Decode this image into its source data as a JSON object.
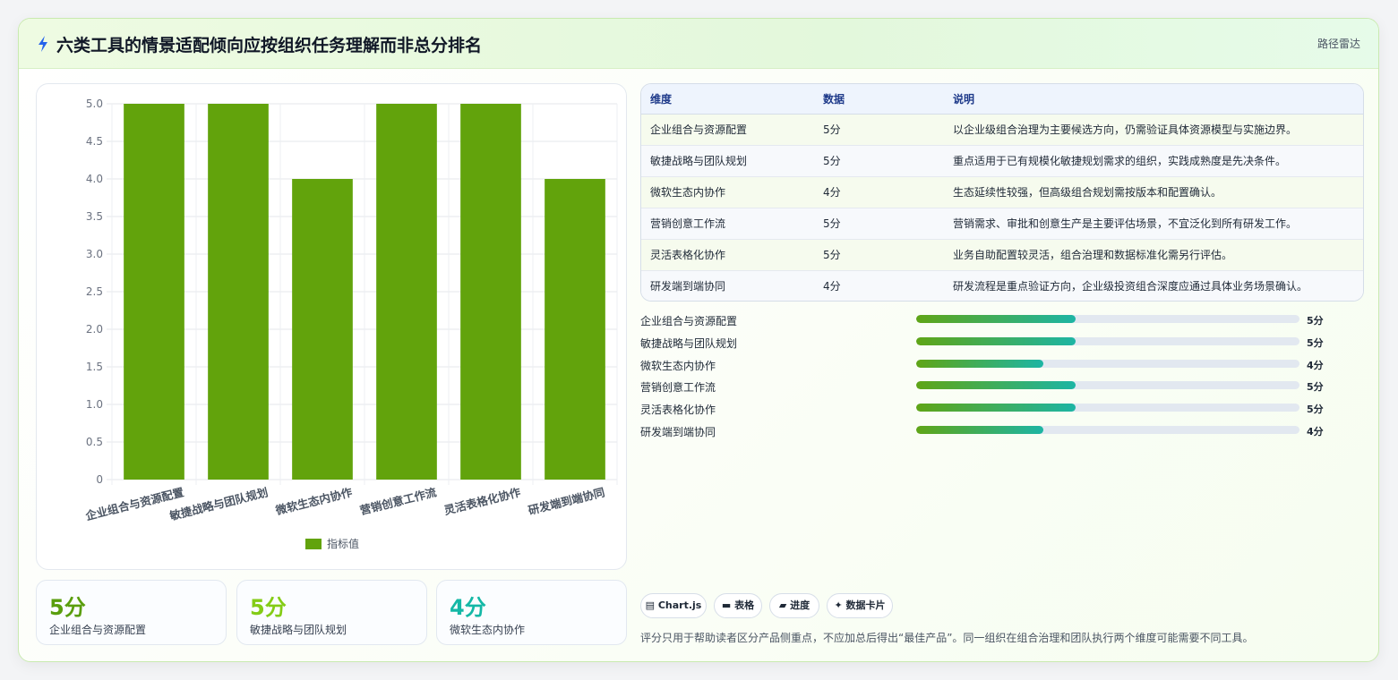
{
  "header": {
    "title": "六类工具的情景适配倾向应按组织任务理解而非总分排名",
    "tag": "路径雷达"
  },
  "chart_data": {
    "type": "bar",
    "categories": [
      "企业组合与资源配置",
      "敏捷战略与团队规划",
      "微软生态内协作",
      "营销创意工作流",
      "灵活表格化协作",
      "研发端到端协同"
    ],
    "series": [
      {
        "name": "指标值",
        "values": [
          5,
          5,
          4,
          5,
          5,
          4
        ]
      }
    ],
    "ylim": [
      0,
      5
    ],
    "yticks": [
      "0",
      "0.5",
      "1.0",
      "1.5",
      "2.0",
      "2.5",
      "3.0",
      "3.5",
      "4.0",
      "4.5",
      "5.0"
    ],
    "grid": true,
    "legend": "bottom",
    "bar_color": "#62a30c"
  },
  "stats": [
    {
      "value": "5分",
      "label": "企业组合与资源配置",
      "color": "#5a9e0d"
    },
    {
      "value": "5分",
      "label": "敏捷战略与团队规划",
      "color": "#84cc16"
    },
    {
      "value": "4分",
      "label": "微软生态内协作",
      "color": "#14b8a6"
    }
  ],
  "table": {
    "headers": [
      "维度",
      "数据",
      "说明"
    ],
    "rows": [
      [
        "企业组合与资源配置",
        "5分",
        "以企业级组合治理为主要候选方向，仍需验证具体资源模型与实施边界。"
      ],
      [
        "敏捷战略与团队规划",
        "5分",
        "重点适用于已有规模化敏捷规划需求的组织，实践成熟度是先决条件。"
      ],
      [
        "微软生态内协作",
        "4分",
        "生态延续性较强，但高级组合规划需按版本和配置确认。"
      ],
      [
        "营销创意工作流",
        "5分",
        "营销需求、审批和创意生产是主要评估场景，不宜泛化到所有研发工作。"
      ],
      [
        "灵活表格化协作",
        "5分",
        "业务自助配置较灵活，组合治理和数据标准化需另行评估。"
      ],
      [
        "研发端到端协同",
        "4分",
        "研发流程是重点验证方向，企业级投资组合深度应通过具体业务场景确认。"
      ]
    ]
  },
  "progress": [
    {
      "label": "企业组合与资源配置",
      "value": "5分",
      "fraction": 0.415
    },
    {
      "label": "敏捷战略与团队规划",
      "value": "5分",
      "fraction": 0.415
    },
    {
      "label": "微软生态内协作",
      "value": "4分",
      "fraction": 0.332
    },
    {
      "label": "营销创意工作流",
      "value": "5分",
      "fraction": 0.415
    },
    {
      "label": "灵活表格化协作",
      "value": "5分",
      "fraction": 0.415
    },
    {
      "label": "研发端到端协同",
      "value": "4分",
      "fraction": 0.332
    }
  ],
  "chips": [
    {
      "label": "▤ Chart.js",
      "icon": "chart-icon"
    },
    {
      "label": "▬ 表格",
      "icon": "table-icon"
    },
    {
      "label": "▰ 进度",
      "icon": "progress-icon"
    },
    {
      "label": "✦ 数据卡片",
      "icon": "card-icon"
    }
  ],
  "footnote": "评分只用于帮助读者区分产品侧重点，不应加总后得出“最佳产品”。同一组织在组合治理和团队执行两个维度可能需要不同工具。"
}
